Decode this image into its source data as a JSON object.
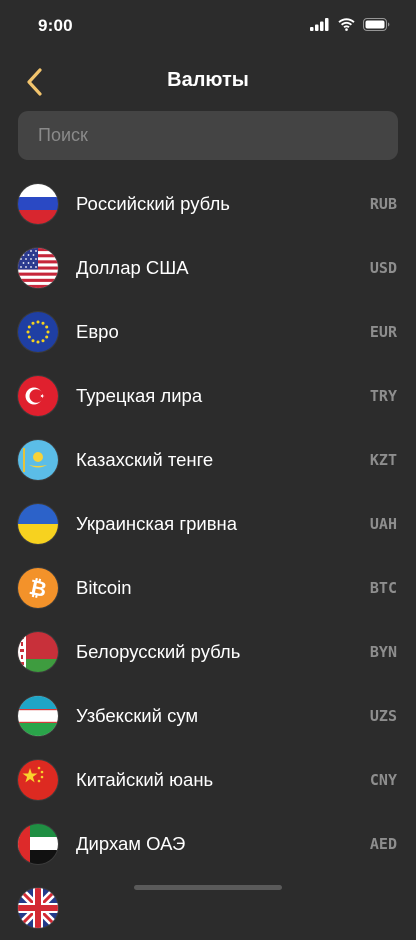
{
  "status_bar": {
    "time": "9:00"
  },
  "header": {
    "title": "Валюты",
    "back_icon": "chevron-left-icon",
    "accent_color": "#f2c46d"
  },
  "search": {
    "placeholder": "Поиск",
    "value": ""
  },
  "currencies": [
    {
      "name": "Российский рубль",
      "code": "RUB",
      "flag": "russia-flag-icon"
    },
    {
      "name": "Доллар США",
      "code": "USD",
      "flag": "usa-flag-icon"
    },
    {
      "name": "Евро",
      "code": "EUR",
      "flag": "eu-flag-icon"
    },
    {
      "name": "Турецкая лира",
      "code": "TRY",
      "flag": "turkey-flag-icon"
    },
    {
      "name": "Казахский тенге",
      "code": "KZT",
      "flag": "kazakhstan-flag-icon"
    },
    {
      "name": "Украинская гривна",
      "code": "UAH",
      "flag": "ukraine-flag-icon"
    },
    {
      "name": "Bitcoin",
      "code": "BTC",
      "flag": "bitcoin-icon"
    },
    {
      "name": "Белорусский рубль",
      "code": "BYN",
      "flag": "belarus-flag-icon"
    },
    {
      "name": "Узбекский сум",
      "code": "UZS",
      "flag": "uzbekistan-flag-icon"
    },
    {
      "name": "Китайский юань",
      "code": "CNY",
      "flag": "china-flag-icon"
    },
    {
      "name": "Дирхам ОАЭ",
      "code": "AED",
      "flag": "uae-flag-icon"
    },
    {
      "name": "",
      "code": "",
      "flag": "uk-flag-icon"
    }
  ]
}
